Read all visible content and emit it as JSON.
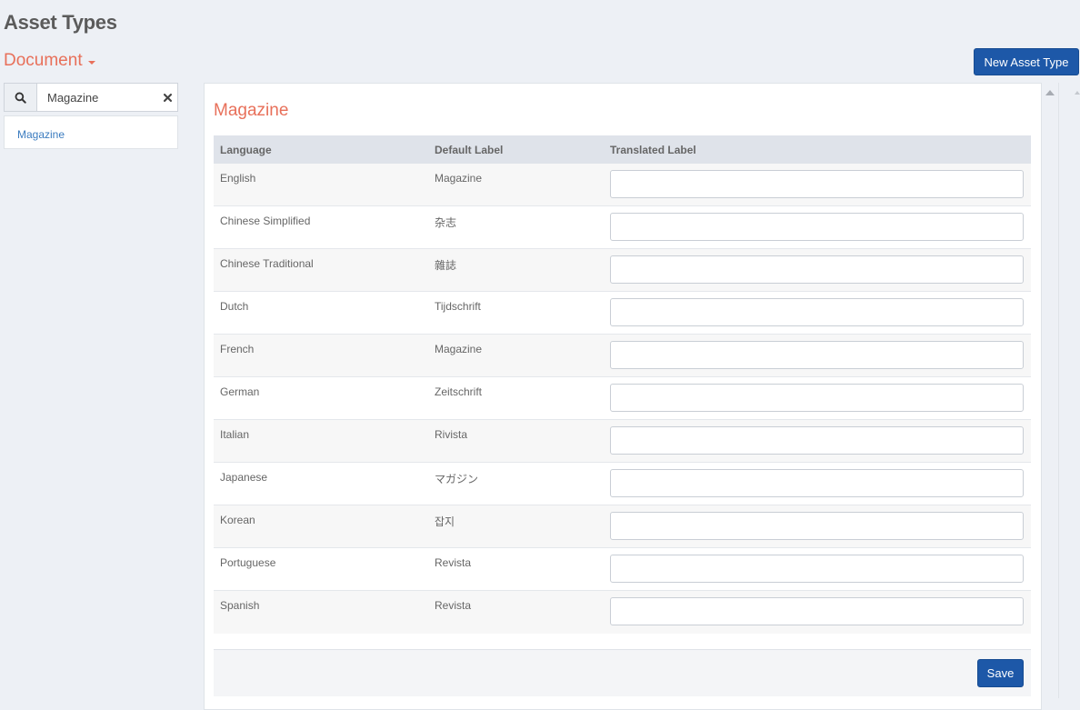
{
  "page": {
    "title": "Asset Types"
  },
  "category_dropdown": {
    "selected": "Document"
  },
  "new_button": {
    "label": "New Asset Type"
  },
  "search": {
    "value": "Magazine",
    "icon": "search-icon",
    "clear_icon": "close-icon"
  },
  "results": [
    {
      "label": "Magazine"
    }
  ],
  "panel": {
    "title": "Magazine",
    "columns": {
      "language": "Language",
      "default_label": "Default Label",
      "translated_label": "Translated Label"
    },
    "rows": [
      {
        "language": "English",
        "default_label": "Magazine",
        "translated_label": ""
      },
      {
        "language": "Chinese Simplified",
        "default_label": "杂志",
        "translated_label": ""
      },
      {
        "language": "Chinese Traditional",
        "default_label": "雜誌",
        "translated_label": ""
      },
      {
        "language": "Dutch",
        "default_label": "Tijdschrift",
        "translated_label": ""
      },
      {
        "language": "French",
        "default_label": "Magazine",
        "translated_label": ""
      },
      {
        "language": "German",
        "default_label": "Zeitschrift",
        "translated_label": ""
      },
      {
        "language": "Italian",
        "default_label": "Rivista",
        "translated_label": ""
      },
      {
        "language": "Japanese",
        "default_label": "マガジン",
        "translated_label": ""
      },
      {
        "language": "Korean",
        "default_label": "잡지",
        "translated_label": ""
      },
      {
        "language": "Portuguese",
        "default_label": "Revista",
        "translated_label": ""
      },
      {
        "language": "Spanish",
        "default_label": "Revista",
        "translated_label": ""
      }
    ],
    "save_label": "Save"
  },
  "colors": {
    "accent": "#e8705a",
    "primary_button": "#1d58a8",
    "link": "#3a7bbf",
    "background": "#edf0f5"
  }
}
